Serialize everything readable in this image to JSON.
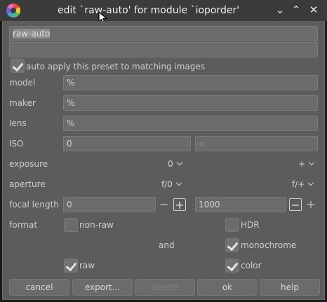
{
  "window": {
    "title": "edit `raw-auto' for module `ioporder'",
    "minimize_glyph": "⌄",
    "maximize_glyph": "⌃",
    "close_glyph": "✕"
  },
  "preset": {
    "name": "raw-auto",
    "description": "",
    "auto_apply_label": "auto apply this preset to matching images",
    "auto_apply_checked": true
  },
  "filters": {
    "model_label": "model",
    "model_value": "%",
    "maker_label": "maker",
    "maker_value": "%",
    "lens_label": "lens",
    "lens_value": "%",
    "iso_label": "ISO",
    "iso_min": "0",
    "iso_max": "∞",
    "exposure_label": "exposure",
    "exposure_min": "0",
    "exposure_max": "+",
    "aperture_label": "aperture",
    "aperture_min": "f/0",
    "aperture_max": "f/+",
    "focal_label": "focal length",
    "focal_min": "0",
    "focal_max": "1000",
    "minus": "−",
    "plus": "+"
  },
  "format": {
    "label": "format",
    "and_label": "and",
    "non_raw_label": "non-raw",
    "non_raw_checked": false,
    "raw_label": "raw",
    "raw_checked": true,
    "hdr_label": "HDR",
    "hdr_checked": false,
    "monochrome_label": "monochrome",
    "monochrome_checked": true,
    "color_label": "color",
    "color_checked": true
  },
  "buttons": {
    "cancel": "cancel",
    "export": "export...",
    "delete": "delete",
    "ok": "ok",
    "help": "help"
  }
}
